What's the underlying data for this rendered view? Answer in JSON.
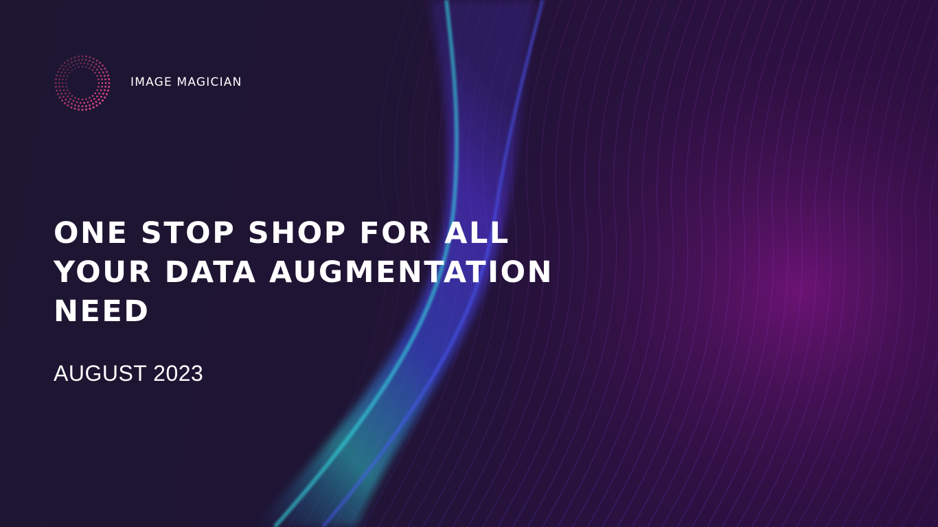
{
  "brand": {
    "name": "IMAGE MAGICIAN",
    "logo_icon": "dotted-ring-logo-icon"
  },
  "headline": {
    "lines": [
      "ONE STOP SHOP FOR ALL",
      "YOUR DATA AUGMENTATION",
      "NEED"
    ]
  },
  "date": "AUGUST 2023",
  "colors": {
    "background": "#1c1631",
    "accent_cyan": "#2fd3d8",
    "accent_blue": "#4a3cff",
    "accent_magenta": "#b021c8",
    "logo_pink": "#e0488f",
    "text": "#ffffff"
  }
}
